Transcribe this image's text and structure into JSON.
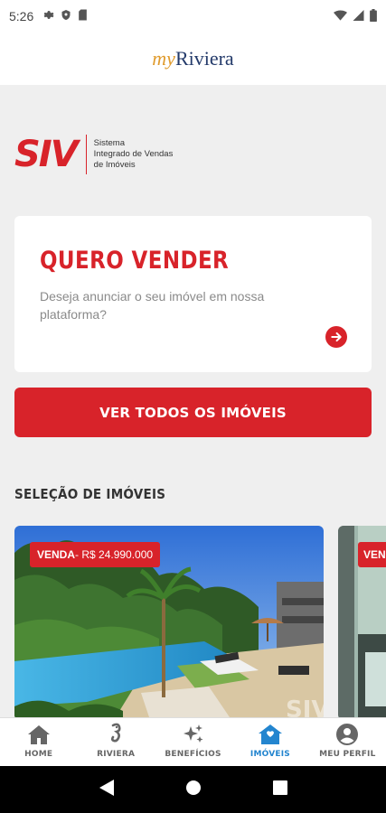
{
  "status_bar": {
    "time": "5:26"
  },
  "header": {
    "logo_my": "my",
    "logo_riviera": "Riviera"
  },
  "siv": {
    "mark": "SIV",
    "line1": "Sistema",
    "line2": "Integrado de Vendas",
    "line3": "de Imóveis"
  },
  "sell_card": {
    "title": "QUERO VENDER",
    "description": "Deseja anunciar o seu imóvel em nossa plataforma?"
  },
  "cta": {
    "label": "VER TODOS OS IMÓVEIS"
  },
  "section": {
    "title": "SELEÇÃO DE IMÓVEIS"
  },
  "properties": [
    {
      "kind": "VENDA",
      "price": " - R$ 24.990.000"
    },
    {
      "kind": "VEND",
      "price": ""
    }
  ],
  "bottom_nav": [
    {
      "label": "HOME",
      "icon": "home-icon"
    },
    {
      "label": "RIVIERA",
      "icon": "seahorse-icon"
    },
    {
      "label": "BENEFÍCIOS",
      "icon": "sparkles-icon"
    },
    {
      "label": "IMÓVEIS",
      "icon": "house-icon",
      "active": true
    },
    {
      "label": "MEU PERFIL",
      "icon": "profile-icon"
    }
  ],
  "colors": {
    "brand_red": "#d8232a",
    "active_blue": "#2385cf",
    "logo_gold": "#e09b2d",
    "logo_navy": "#233a6a"
  }
}
